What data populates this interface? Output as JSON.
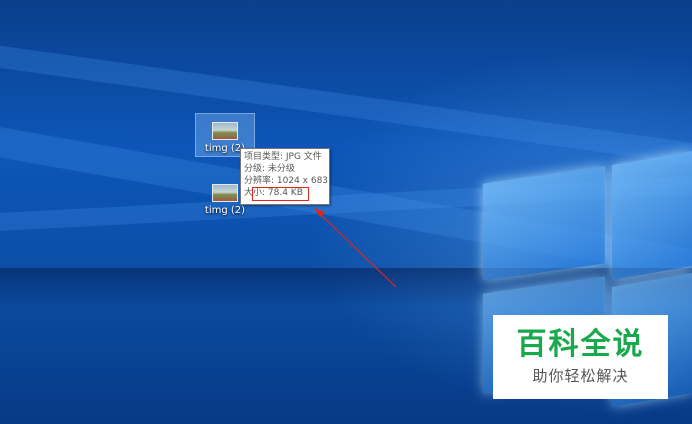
{
  "desktop": {
    "icons": [
      {
        "label": "timg (2)",
        "icon": "image-file-icon",
        "selected": true
      },
      {
        "label": "timg (2)",
        "icon": "image-file-icon",
        "selected": false
      }
    ]
  },
  "tooltip": {
    "type_line": "项目类型: JPG 文件",
    "rating_line": "分级: 未分级",
    "resolution_line": "分辨率: 1024 x 683",
    "size_line": "大小: 78.4 KB"
  },
  "annotation": {
    "color": "#e0261c"
  },
  "watermark": {
    "title": "百科全说",
    "subtitle": "助你轻松解决",
    "title_color": "#1aa84d"
  }
}
